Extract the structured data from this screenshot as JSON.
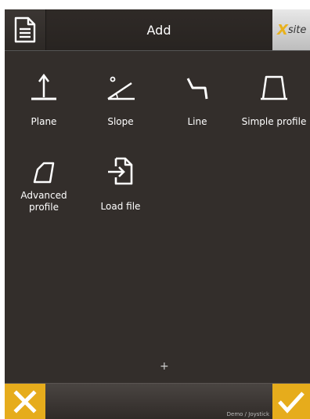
{
  "header": {
    "title": "Add",
    "doc_icon": "document-icon",
    "logo_x": "X",
    "logo_text": "site"
  },
  "items": [
    {
      "label": "Plane",
      "icon": "plane-icon"
    },
    {
      "label": "Slope",
      "icon": "slope-icon"
    },
    {
      "label": "Line",
      "icon": "line-icon"
    },
    {
      "label": "Simple profile",
      "icon": "simple-profile-icon"
    },
    {
      "label": "Advanced\nprofile",
      "icon": "advanced-profile-icon"
    },
    {
      "label": "Load file",
      "icon": "load-file-icon"
    }
  ],
  "crosshair": "+",
  "footer": {
    "mode_text": "Demo / Joystick",
    "cancel_icon": "close-icon",
    "ok_icon": "checkmark-icon"
  },
  "colors": {
    "background": "#332e2b",
    "accent": "#e6ac1c"
  }
}
